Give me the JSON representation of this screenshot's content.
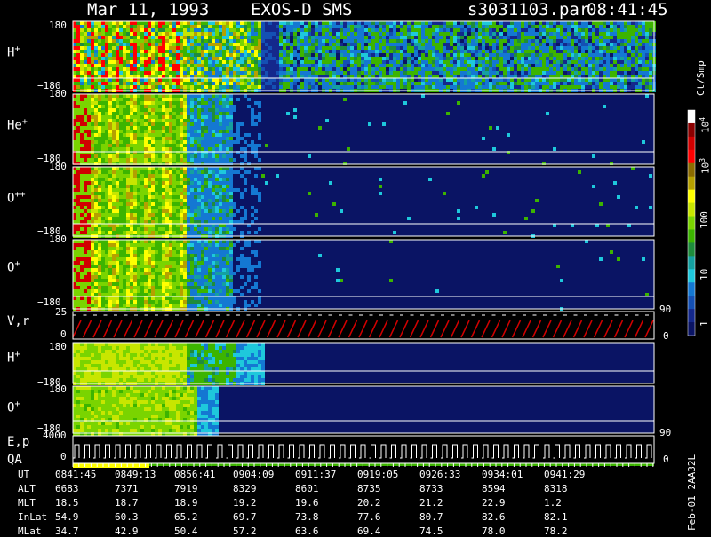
{
  "header": {
    "date": "Mar 11, 1993",
    "instrument": "EXOS-D SMS",
    "file": "s3031103.par",
    "time": "08:41:45"
  },
  "panels": [
    {
      "id": "H+",
      "label_base": "H",
      "label_sup": "+",
      "ymax": "180",
      "ymin": "−180"
    },
    {
      "id": "He+",
      "label_base": "He",
      "label_sup": "+",
      "ymax": "180",
      "ymin": "−180"
    },
    {
      "id": "O++",
      "label_base": "O",
      "label_sup": "++",
      "ymax": "180",
      "ymin": "−180"
    },
    {
      "id": "O+",
      "label_base": "O",
      "label_sup": "+",
      "ymax": "180",
      "ymin": "−180"
    },
    {
      "id": "Vr",
      "label_base": "V,r",
      "label_sup": "",
      "ymax": "25",
      "ymin": "0",
      "right_top": "90",
      "right_bottom": "0"
    },
    {
      "id": "H+2",
      "label_base": "H",
      "label_sup": "+",
      "ymax": "180",
      "ymin": "−180"
    },
    {
      "id": "O+2",
      "label_base": "O",
      "label_sup": "+",
      "ymax": "180",
      "ymin": "−180"
    },
    {
      "id": "Ep",
      "label_base": "E,p",
      "label_sup": "",
      "ymax": "4000",
      "ymin": "0",
      "right_top": "90",
      "right_bottom": "0"
    },
    {
      "id": "QA",
      "label_base": "QA",
      "label_sup": ""
    }
  ],
  "colorbar": {
    "unit": "Ct/Smp",
    "ticks": [
      {
        "base": "10",
        "sup": "4"
      },
      {
        "base": "10",
        "sup": "3"
      },
      {
        "base": "100",
        "sup": ""
      },
      {
        "base": "10",
        "sup": ""
      },
      {
        "base": "1",
        "sup": ""
      }
    ],
    "colors": [
      "#ffffff",
      "#8b0000",
      "#d00000",
      "#ff0000",
      "#8b6b00",
      "#b5a000",
      "#ffff00",
      "#c8e600",
      "#7ad400",
      "#3cb400",
      "#1e8c3c",
      "#14a0a0",
      "#1ec8dc",
      "#1478d2",
      "#1450b4",
      "#14288c",
      "#0a1464"
    ]
  },
  "chart_data": {
    "type": "heatmap",
    "title": "Mar 11, 1993   EXOS-D SMS",
    "x_axis_label": "UT",
    "x_ticks": [
      "0841:45",
      "0849:13",
      "0856:41",
      "0904:09",
      "0911:37",
      "0919:05",
      "0926:33",
      "0934:01",
      "0941:29"
    ],
    "ephemeris": [
      {
        "name": "UT",
        "values": [
          "0841:45",
          "0849:13",
          "0856:41",
          "0904:09",
          "0911:37",
          "0919:05",
          "0926:33",
          "0934:01",
          "0941:29"
        ]
      },
      {
        "name": "ALT",
        "values": [
          "6683",
          "7371",
          "7919",
          "8329",
          "8601",
          "8735",
          "8733",
          "8594",
          "8318"
        ]
      },
      {
        "name": "MLT",
        "values": [
          "18.5",
          "18.7",
          "18.9",
          "19.2",
          "19.6",
          "20.2",
          "21.2",
          "22.9",
          "1.2"
        ]
      },
      {
        "name": "InLat",
        "values": [
          "54.9",
          "60.3",
          "65.2",
          "69.7",
          "73.8",
          "77.6",
          "80.7",
          "82.6",
          "82.1"
        ]
      },
      {
        "name": "MLat",
        "values": [
          "34.7",
          "42.9",
          "50.4",
          "57.2",
          "63.6",
          "69.4",
          "74.5",
          "78.0",
          "78.2"
        ]
      }
    ],
    "colorbar_scale": "log",
    "colorbar_range": [
      1,
      10000
    ]
  },
  "footer": {
    "stamp": "Feb-01 2AA32L"
  }
}
